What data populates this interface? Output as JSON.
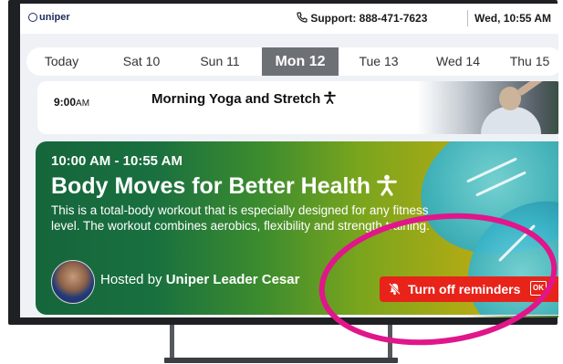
{
  "header": {
    "logo_text": "uniper",
    "support_text": "Support: 888-471-7623",
    "datetime": "Wed, 10:55 AM"
  },
  "days": [
    {
      "label": "Today",
      "active": false
    },
    {
      "label": "Sat 10",
      "active": false
    },
    {
      "label": "Sun 11",
      "active": false
    },
    {
      "label": "Mon 12",
      "active": true
    },
    {
      "label": "Tue 13",
      "active": false
    },
    {
      "label": "Wed 14",
      "active": false
    },
    {
      "label": "Thu 15",
      "active": false
    }
  ],
  "upcoming": {
    "time": "9:00",
    "ampm": "AM",
    "title": "Morning Yoga and Stretch"
  },
  "featured": {
    "time_range": "10:00 AM - 10:55 AM",
    "title": "Body Moves for Better Health",
    "description": "This is a total-body workout that is especially designed for any fitness level. The workout combines aerobics, flexibility and strength training.",
    "host_prefix": "Hosted by",
    "host_name": "Uniper Leader Cesar",
    "reminder_button": "Turn off reminders",
    "ok_hint": "OK"
  },
  "colors": {
    "accent_red": "#e8231a",
    "highlight_ring": "#e0168a",
    "active_day": "#6d7075"
  },
  "icons": [
    "phone-icon",
    "accessibility-icon",
    "bell-off-icon",
    "ok-key-icon"
  ]
}
